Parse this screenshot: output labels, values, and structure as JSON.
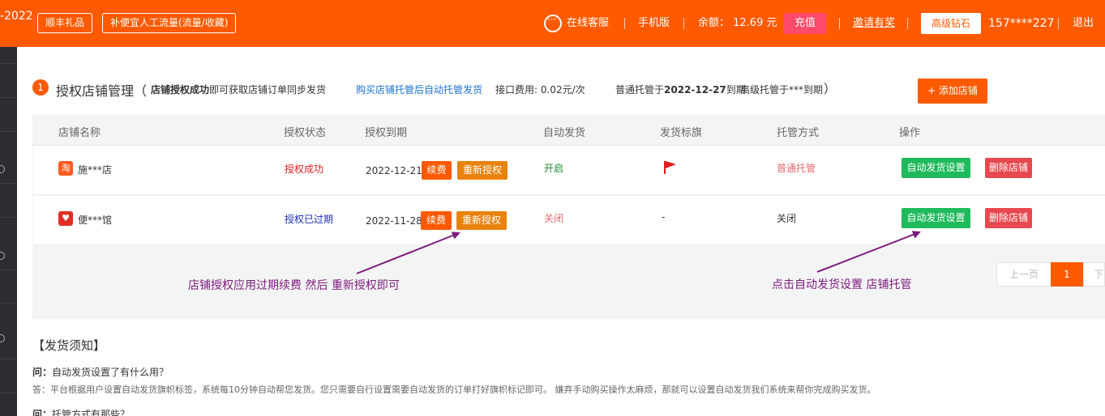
{
  "topbar": {
    "brand": "-2022",
    "pill_gift": "顺丰礼品",
    "pill_traffic": "补便宜人工流量(流量/收藏)",
    "online_service": "在线客服",
    "mobile": "手机版",
    "balance": "余额：  12.69 元",
    "recharge": "充值",
    "invite": "邀请有奖",
    "vip_level": "高级钻石",
    "user_phone": "157****227",
    "logout": "退出"
  },
  "section": {
    "number": "1",
    "title": "授权店铺管理（",
    "desc_bold": "店铺授权成功",
    "desc_rest": "即可获取店铺订单同步发货",
    "desc_link": "购买店铺托管后自动托管发货",
    "fee": "接口费用: 0.02元/次",
    "normal_prefix": "普通托管于",
    "normal_date": "2022-12-27",
    "normal_suffix": "到期",
    "advanced": "高级托管于***到期",
    "close_paren": "）",
    "add_button": "+ 添加店铺"
  },
  "table": {
    "headers": [
      "店铺名称",
      "授权状态",
      "授权到期",
      "自动发货",
      "发货标旗",
      "托管方式",
      "操作"
    ],
    "rows": [
      {
        "shop_name": "施***店",
        "platform_icon": "taobao-icon",
        "auth_status": "授权成功",
        "expire_date": "2022-12-21",
        "renew": "续费",
        "reauth": "重新授权",
        "auto_ship": "开启",
        "flag": "red-flag-icon",
        "hosting": "普通托管",
        "settings": "自动发货设置",
        "delete": "删除店铺"
      },
      {
        "shop_name": "便***馆",
        "platform_icon": "pinduoduo-icon",
        "auth_status": "授权已过期",
        "expire_date": "2022-11-28",
        "renew": "续费",
        "reauth": "重新授权",
        "auto_ship": "关闭",
        "flag": "-",
        "hosting": "关闭",
        "settings": "自动发货设置",
        "delete": "删除店铺"
      }
    ]
  },
  "annotations": {
    "left": "店铺授权应用过期续费 然后 重新授权即可",
    "right": "点击自动发货设置 店铺托管"
  },
  "pagination": {
    "prev": "上一页",
    "current": "1",
    "next": "下"
  },
  "notes": {
    "title": "【发货须知】",
    "q1_label": "问：",
    "q1": "自动发货设置了有什么用？",
    "a1": "答：平台根据用户设置自动发货旗帜标签，系统每10分钟自动帮您发货。您只需要自行设置需要自动发货的订单打好旗帜标记即可。 嫌弃手动购买操作太麻烦，那就可以设置自动发货我们系统来帮你完成购买发货。",
    "q2_label": "问：",
    "q2": "托管方式有那些？"
  },
  "colors": {
    "brand": "#ff5a00",
    "success_green": "#1fba5c",
    "danger_red": "#e8484f",
    "annotation_purple": "#7d1a7d"
  }
}
